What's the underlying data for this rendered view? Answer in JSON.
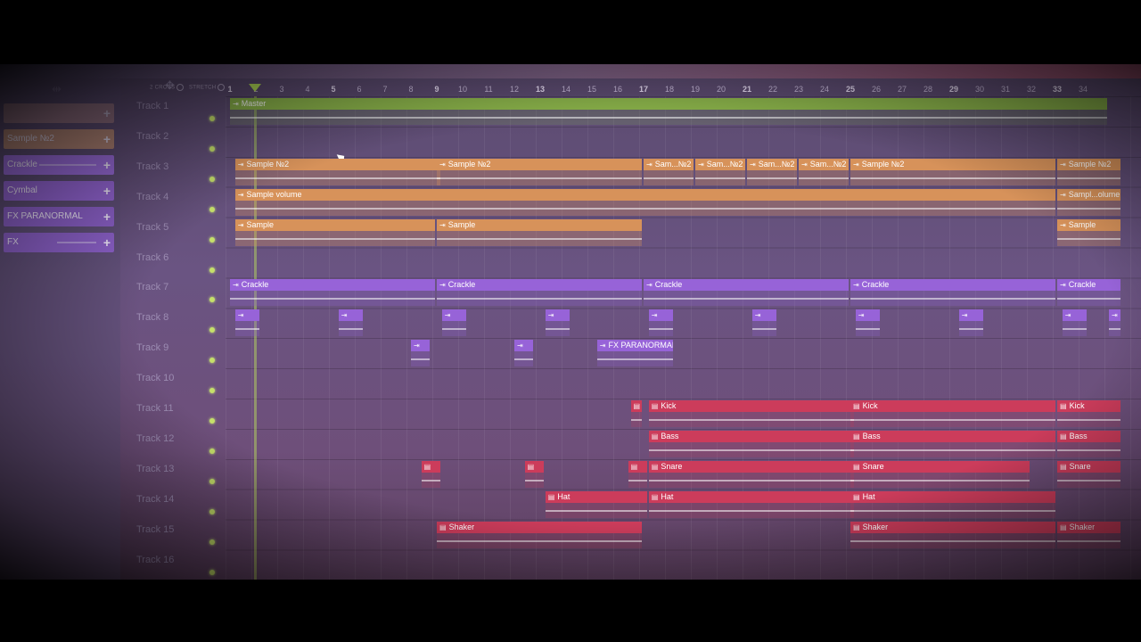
{
  "toolbar": {
    "icons": [
      "magnet-icon",
      "arrow-icon"
    ],
    "xcross_label": "2 CROSS",
    "stretch_label": "STRETCH"
  },
  "ruler": {
    "numbers": [
      "1",
      "2",
      "3",
      "4",
      "5",
      "6",
      "7",
      "8",
      "9",
      "10",
      "11",
      "12",
      "13",
      "14",
      "15",
      "16",
      "17",
      "18",
      "19",
      "20",
      "21",
      "22",
      "23",
      "24",
      "25",
      "26",
      "27",
      "28",
      "29",
      "30",
      "31",
      "32",
      "33",
      "34"
    ],
    "bold_bars": [
      "1",
      "5",
      "9",
      "13",
      "17",
      "21",
      "25",
      "29",
      "33"
    ]
  },
  "channels": [
    {
      "label": "",
      "color": "#c58a8a"
    },
    {
      "label": "Sample №2",
      "color": "#c98c6e"
    },
    {
      "label": "Crackle",
      "color": "#9d6ee0"
    },
    {
      "label": "Cymbal",
      "color": "#9d6ee0"
    },
    {
      "label": "FX PARANORMAL",
      "color": "#8e62cc"
    },
    {
      "label": "FX",
      "color": "#8e62cc"
    }
  ],
  "tracks": [
    "Track 1",
    "Track 2",
    "Track 3",
    "Track 4",
    "Track 5",
    "Track 6",
    "Track 7",
    "Track 8",
    "Track 9",
    "Track 10",
    "Track 11",
    "Track 12",
    "Track 13",
    "Track 14",
    "Track 15",
    "Track 16"
  ],
  "clip_labels": {
    "master": "Master",
    "sample2": "Sample №2",
    "sample2_short": "Sam...№2",
    "sample_volume": "Sample volume",
    "sample_volume_cut": "Sampl...olume",
    "sample": "Sample",
    "crackle": "Crackle",
    "fx_paranormal": "FX PARANORMAL",
    "kick": "Kick",
    "bass": "Bass",
    "snare": "Snare",
    "hat": "Hat",
    "shaker": "Shaker"
  },
  "colors": {
    "orange": "#d7925a",
    "violet": "#9763d8",
    "pink": "#cc3c5b",
    "master": "#8ab24a",
    "playhead": "#b8e25a"
  }
}
